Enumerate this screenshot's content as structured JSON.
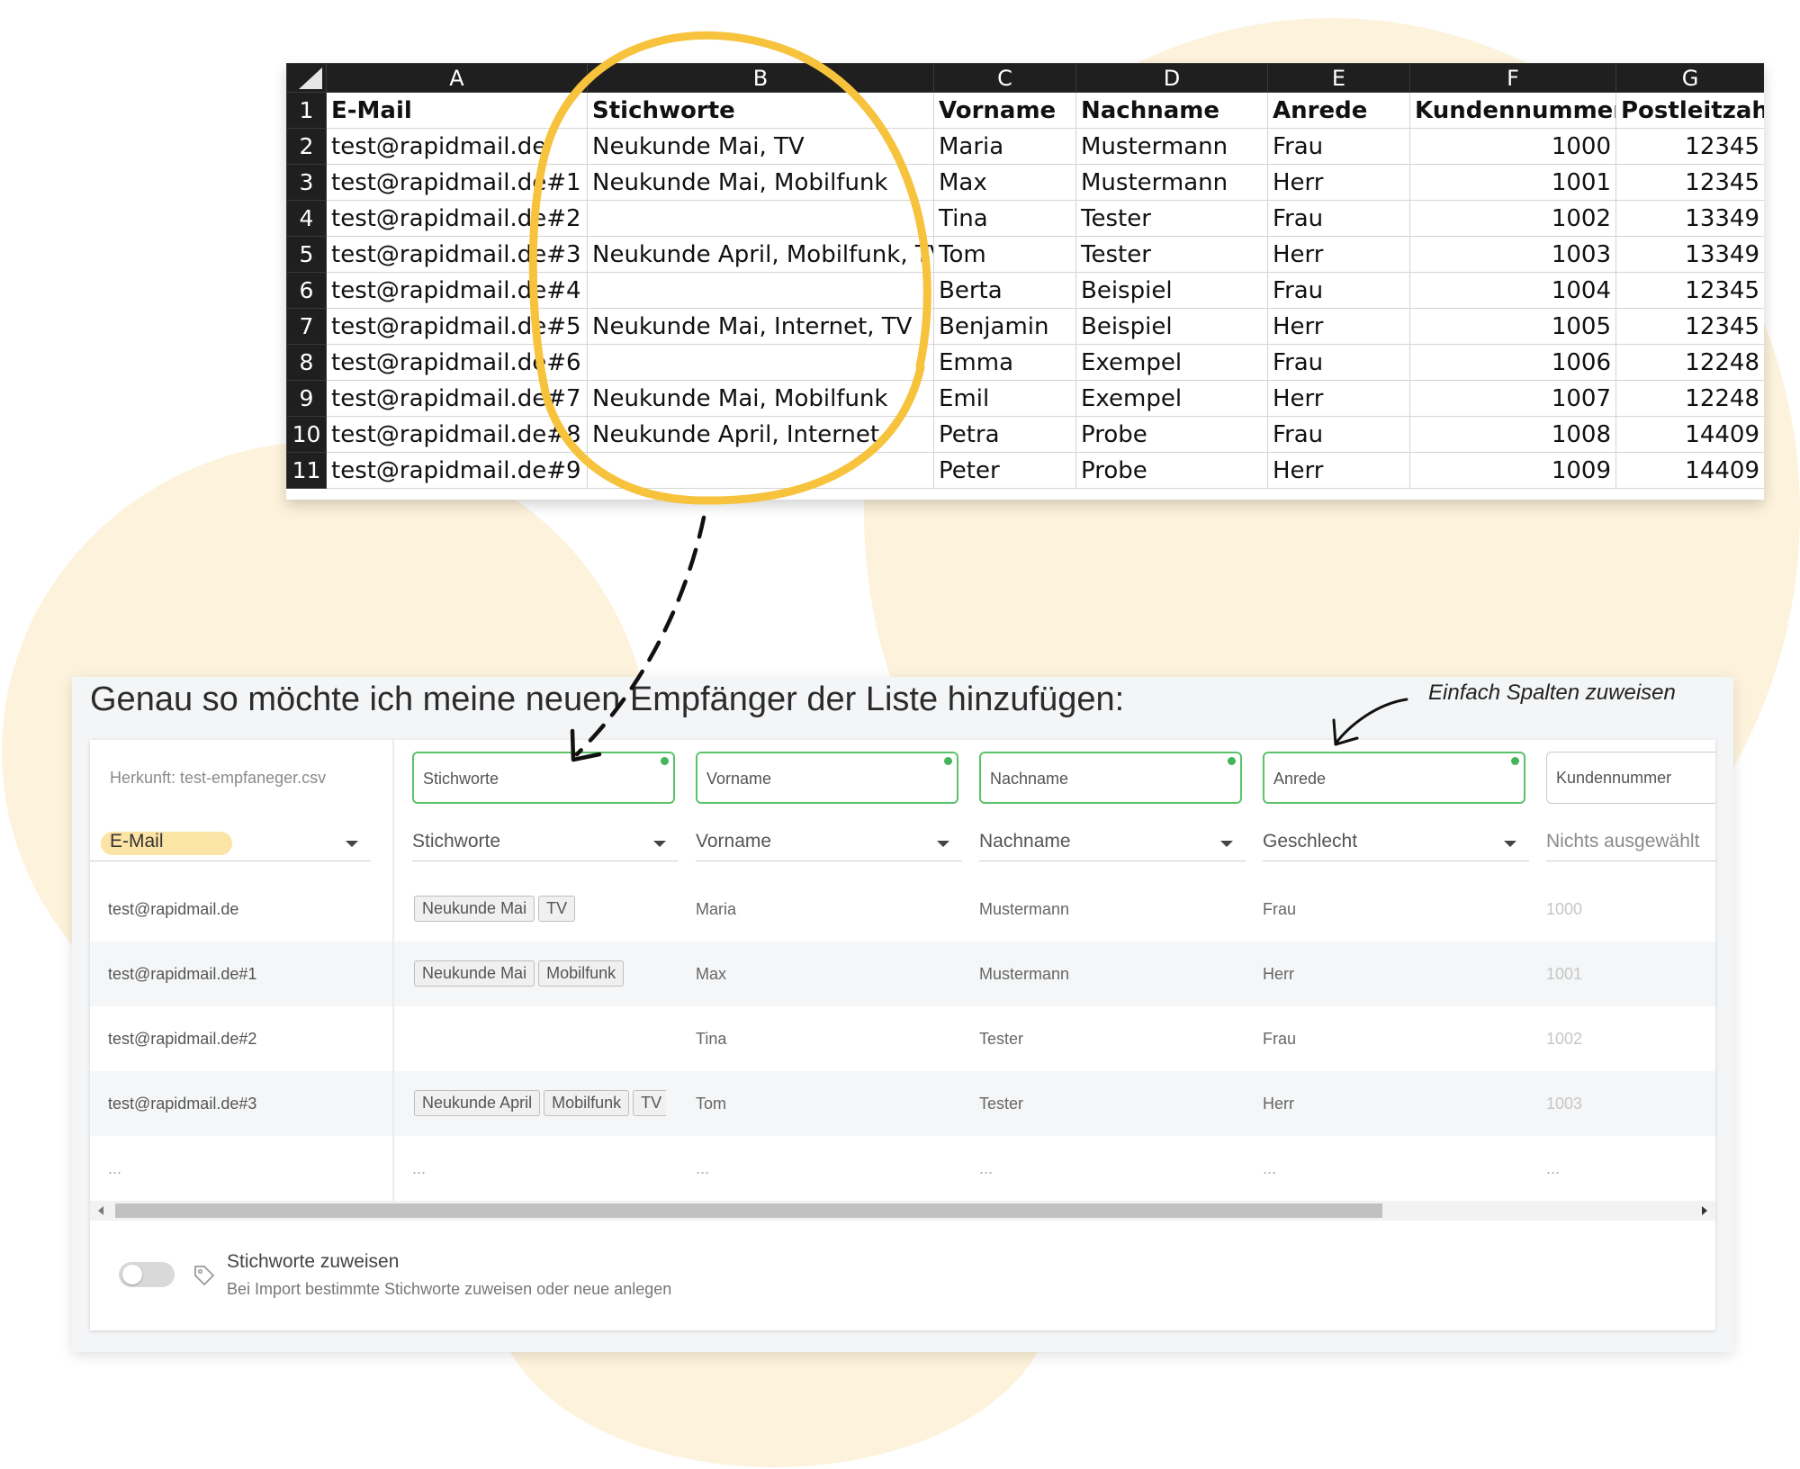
{
  "spreadsheet": {
    "column_letters": [
      "A",
      "B",
      "C",
      "D",
      "E",
      "F",
      "G"
    ],
    "row_numbers": [
      "1",
      "2",
      "3",
      "4",
      "5",
      "6",
      "7",
      "8",
      "9",
      "10",
      "11"
    ],
    "header_row": [
      "E-Mail",
      "Stichworte",
      "Vorname",
      "Nachname",
      "Anrede",
      "Kundennummer",
      "Postleitzahl"
    ],
    "rows": [
      [
        "test@rapidmail.de",
        "Neukunde Mai, TV",
        "Maria",
        "Mustermann",
        "Frau",
        "1000",
        "12345"
      ],
      [
        "test@rapidmail.de#1",
        "Neukunde Mai, Mobilfunk",
        "Max",
        "Mustermann",
        "Herr",
        "1001",
        "12345"
      ],
      [
        "test@rapidmail.de#2",
        "",
        "Tina",
        "Tester",
        "Frau",
        "1002",
        "13349"
      ],
      [
        "test@rapidmail.de#3",
        "Neukunde April, Mobilfunk, TV",
        "Tom",
        "Tester",
        "Herr",
        "1003",
        "13349"
      ],
      [
        "test@rapidmail.de#4",
        "",
        "Berta",
        "Beispiel",
        "Frau",
        "1004",
        "12345"
      ],
      [
        "test@rapidmail.de#5",
        "Neukunde Mai, Internet, TV",
        "Benjamin",
        "Beispiel",
        "Herr",
        "1005",
        "12345"
      ],
      [
        "test@rapidmail.de#6",
        "",
        "Emma",
        "Exempel",
        "Frau",
        "1006",
        "12248"
      ],
      [
        "test@rapidmail.de#7",
        "Neukunde Mai, Mobilfunk",
        "Emil",
        "Exempel",
        "Herr",
        "1007",
        "12248"
      ],
      [
        "test@rapidmail.de#8",
        "Neukunde April, Internet",
        "Petra",
        "Probe",
        "Frau",
        "1008",
        "14409"
      ],
      [
        "test@rapidmail.de#9",
        "",
        "Peter",
        "Probe",
        "Herr",
        "1009",
        "14409"
      ]
    ]
  },
  "import": {
    "headline": "Genau so möchte ich meine neuen Empfänger der Liste hinzufügen:",
    "annotation": "Einfach Spalten zuweisen",
    "source_label": "Herkunft: test-empfaneger.csv",
    "field_boxes": [
      "Stichworte",
      "Vorname",
      "Nachname",
      "Anrede",
      "Kundennummer"
    ],
    "selects": [
      "E-Mail",
      "Stichworte",
      "Vorname",
      "Nachname",
      "Geschlecht",
      "Nichts ausgewählt"
    ],
    "rows": [
      {
        "email": "test@rapidmail.de",
        "tags": [
          "Neukunde Mai",
          "TV"
        ],
        "vorname": "Maria",
        "nachname": "Mustermann",
        "anrede": "Frau",
        "kundennummer": "1000"
      },
      {
        "email": "test@rapidmail.de#1",
        "tags": [
          "Neukunde Mai",
          "Mobilfunk"
        ],
        "vorname": "Max",
        "nachname": "Mustermann",
        "anrede": "Herr",
        "kundennummer": "1001"
      },
      {
        "email": "test@rapidmail.de#2",
        "tags": [],
        "vorname": "Tina",
        "nachname": "Tester",
        "anrede": "Frau",
        "kundennummer": "1002"
      },
      {
        "email": "test@rapidmail.de#3",
        "tags": [
          "Neukunde April",
          "Mobilfunk",
          "TV"
        ],
        "vorname": "Tom",
        "nachname": "Tester",
        "anrede": "Herr",
        "kundennummer": "1003"
      }
    ],
    "ellipsis": "...",
    "option_title": "Stichworte zuweisen",
    "option_subtitle": "Bei Import bestimmte Stichworte zuweisen oder neue anlegen"
  },
  "colors": {
    "highlight_yellow": "#f7c23c",
    "background_blob": "#fdf3dc",
    "mapped_border": "#5cc26a",
    "sheet_header": "#1f1f1f"
  },
  "icons": [
    "dropdown-caret-icon",
    "tag-icon",
    "scroll-left-icon",
    "scroll-right-icon"
  ]
}
